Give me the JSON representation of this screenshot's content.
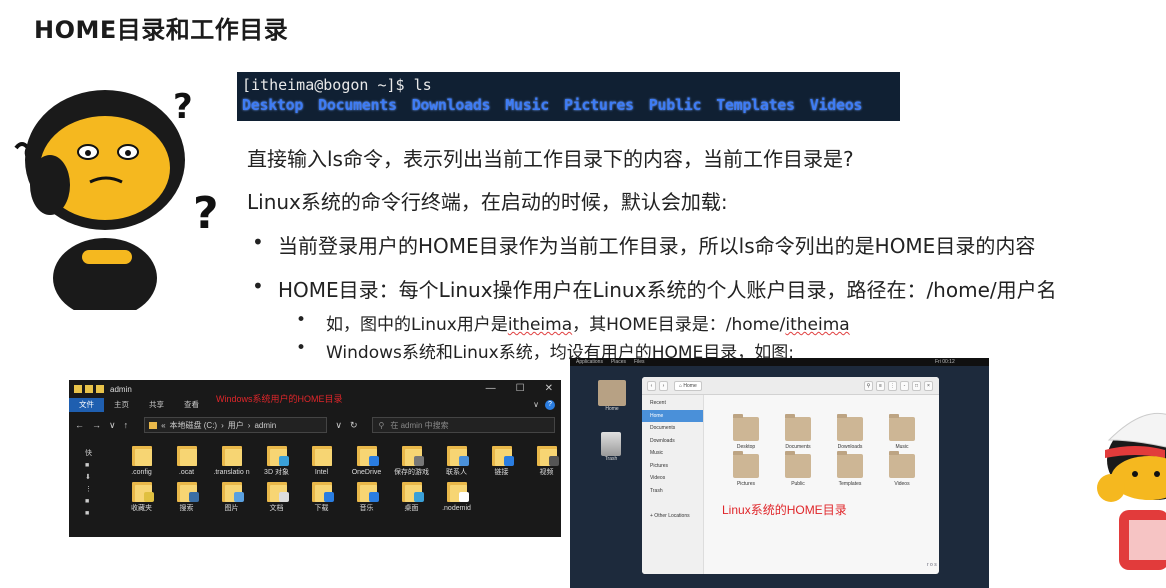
{
  "title": "HOME目录和工作目录",
  "terminal": {
    "prompt_line": "[itheima@bogon ~]$ ls",
    "listing": [
      "Desktop",
      "Documents",
      "Downloads",
      "Music",
      "Pictures",
      "Public",
      "Templates",
      "Videos"
    ],
    "listing_color": "#3e7cf5",
    "background": "#102033"
  },
  "paragraphs": {
    "p1": "直接输入ls命令，表示列出当前工作目录下的内容，当前工作目录是?",
    "p2": "Linux系统的命令行终端，在启动的时候，默认会加载:"
  },
  "bullets": [
    {
      "dot": "•",
      "text": "当前登录用户的HOME目录作为当前工作目录，所以ls命令列出的是HOME目录的内容"
    },
    {
      "dot": "•",
      "text": "HOME目录：每个Linux操作用户在Linux系统的个人账户目录，路径在：/home/用户名"
    }
  ],
  "sub_bullets": {
    "s1_prefix": "如，图中的Linux用户是",
    "s1_user": "itheima",
    "s1_mid": "，其HOME目录是：/home/",
    "s1_user2": "itheima",
    "s2": "Windows系统和Linux系统，均设有用户的HOME目录，如图:",
    "dot": "•"
  },
  "windows_explorer": {
    "window_title": "admin",
    "window_controls": [
      "—",
      "☐",
      "✕"
    ],
    "ribbon_tabs": [
      "文件",
      "主页",
      "共享",
      "查看"
    ],
    "red_label": "Windows系统用户的HOME目录",
    "address_path": [
      "«",
      "本地磁盘 (C:)",
      "›",
      "用户",
      "›",
      "admin"
    ],
    "search_placeholder": "在 admin 中搜索",
    "nav_arrows": [
      "←",
      "→",
      "∨",
      "↑"
    ],
    "side_labels": [
      "快",
      "■",
      "⬇",
      "⋮",
      "■",
      "■"
    ],
    "items": [
      {
        "label": ".config",
        "badge": ""
      },
      {
        "label": ".ocat",
        "badge": ""
      },
      {
        "label": ".translatio n",
        "badge": ""
      },
      {
        "label": "3D 对象",
        "badge": "#3aa0d8"
      },
      {
        "label": "Intel",
        "badge": ""
      },
      {
        "label": "OneDrive",
        "badge": "#2a7de1"
      },
      {
        "label": "保存的游戏",
        "badge": "#777777"
      },
      {
        "label": "联系人",
        "badge": "#4a90d9"
      },
      {
        "label": "链接",
        "badge": "#2a7de1"
      },
      {
        "label": "视频",
        "badge": "#555555"
      },
      {
        "label": "收藏夹",
        "badge": "#e0c040"
      },
      {
        "label": "搜索",
        "badge": "#3a6ea5"
      },
      {
        "label": "图片",
        "badge": "#5aa0e0"
      },
      {
        "label": "文档",
        "badge": "#dddddd"
      },
      {
        "label": "下载",
        "badge": "#2a7de1"
      },
      {
        "label": "音乐",
        "badge": "#2a7de1"
      },
      {
        "label": "桌面",
        "badge": "#3aa0d8"
      },
      {
        "label": ".nodemid",
        "badge": "#ffffff"
      }
    ]
  },
  "linux_files": {
    "topbar": [
      "Applications",
      "Places",
      "Files"
    ],
    "clock": "Fri 00:12",
    "desktop_icons": [
      "Home",
      "Trash"
    ],
    "breadcrumb": "⌂ Home",
    "sidebar": [
      "Recent",
      "Home",
      "Documents",
      "Downloads",
      "Music",
      "Pictures",
      "Videos",
      "Trash",
      "",
      "+ Other Locations"
    ],
    "selected_sidebar": "Home",
    "folders": [
      "Desktop",
      "Documents",
      "Downloads",
      "Music",
      "Pictures",
      "Public",
      "Templates",
      "Videos"
    ],
    "red_label": "Linux系统的HOME目录",
    "corner_text": "r o s"
  }
}
